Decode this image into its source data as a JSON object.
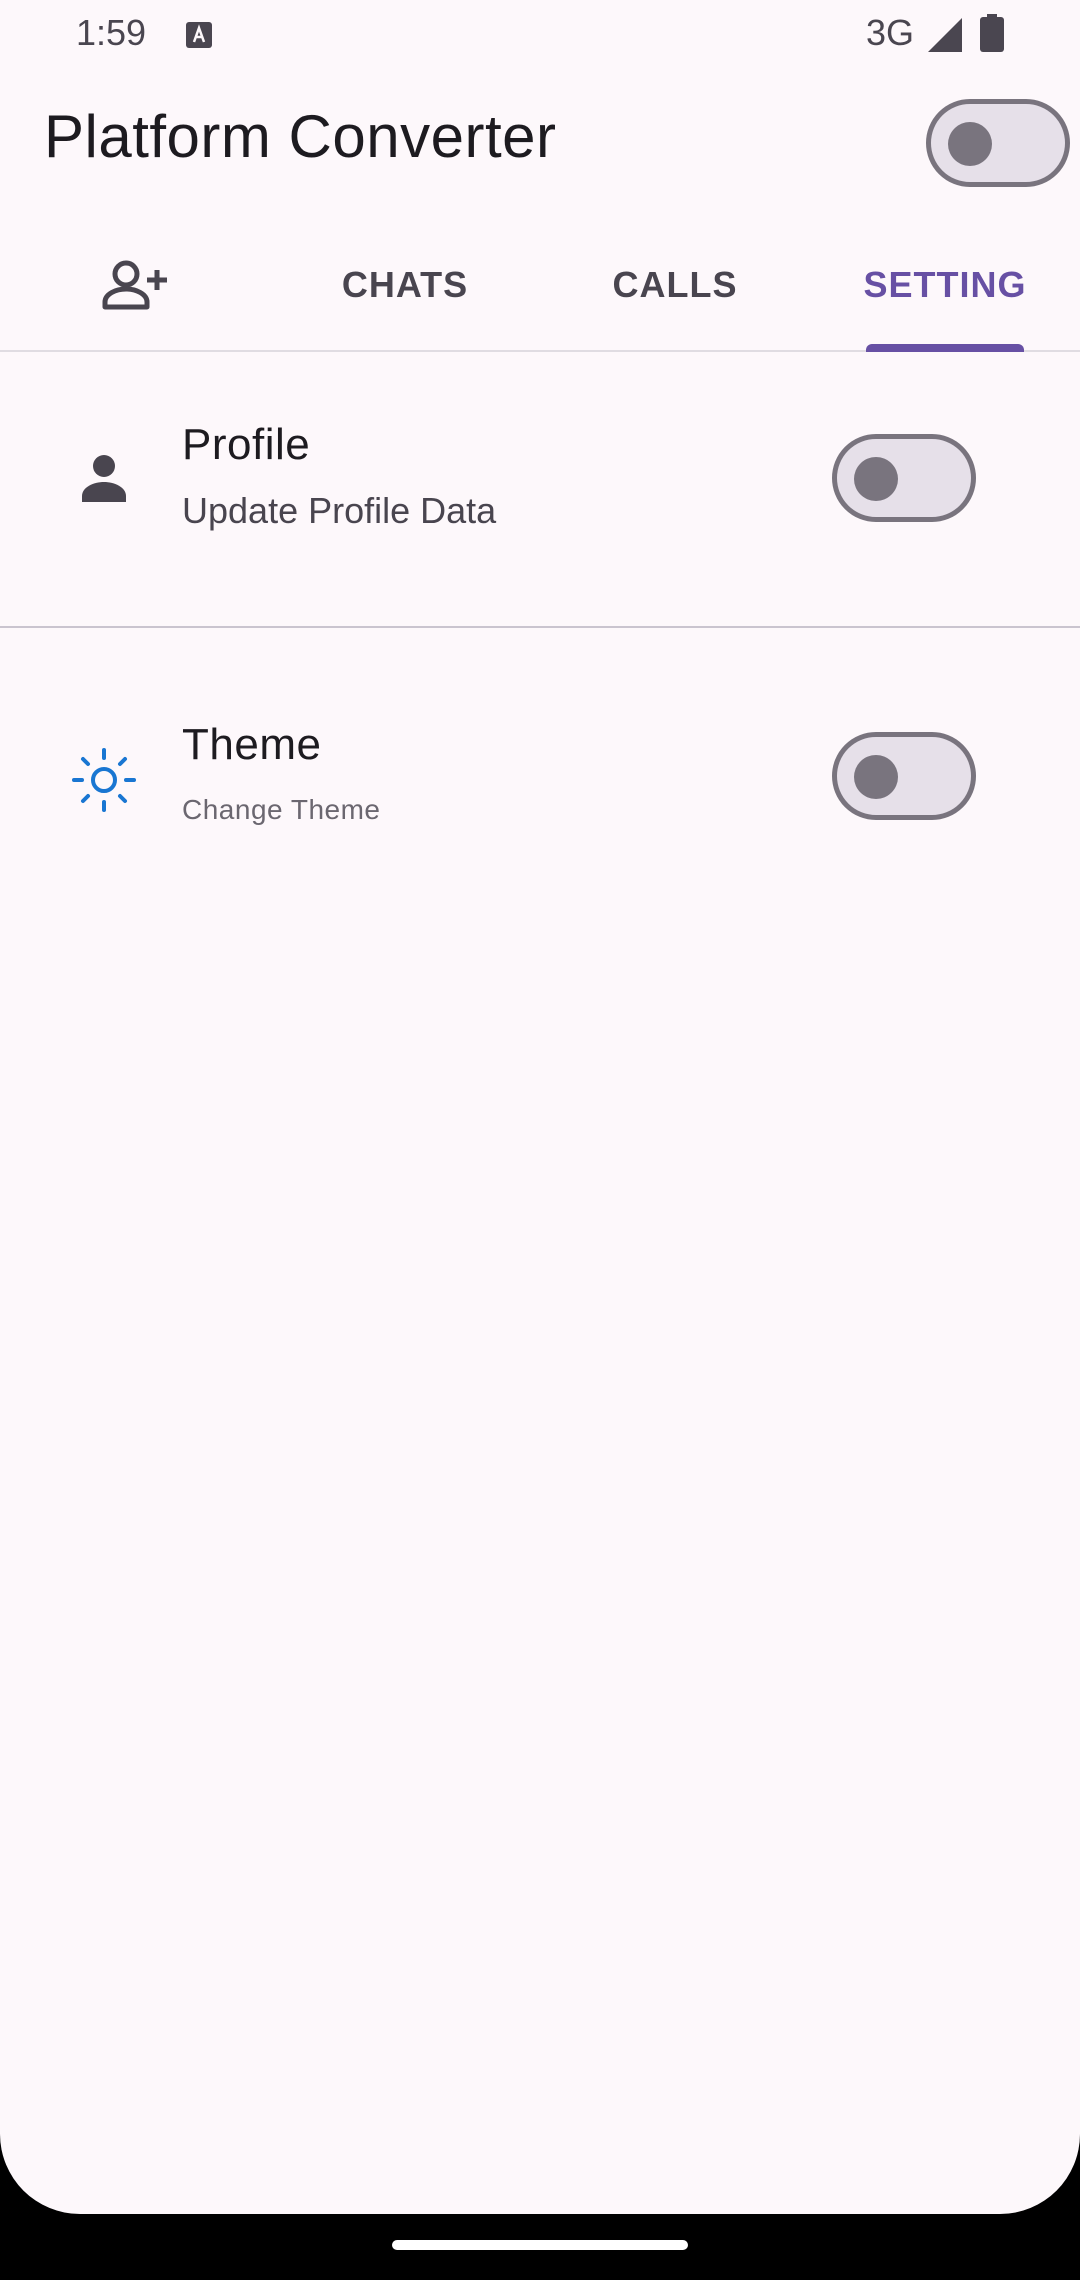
{
  "status_bar": {
    "time": "1:59",
    "network": "3G",
    "icons": [
      "text-a-icon",
      "signal-icon",
      "battery-icon"
    ]
  },
  "app_bar": {
    "title": "Platform Converter",
    "switch_on": false
  },
  "tabs": {
    "items": [
      {
        "label": "",
        "icon": "add-person-icon",
        "selected": false
      },
      {
        "label": "CHATS",
        "selected": false
      },
      {
        "label": "CALLS",
        "selected": false
      },
      {
        "label": "SETTING",
        "selected": true
      }
    ]
  },
  "settings": {
    "profile": {
      "title": "Profile",
      "subtitle": "Update Profile Data",
      "icon": "person-icon",
      "switch_on": false
    },
    "theme": {
      "title": "Theme",
      "subtitle": "Change Theme",
      "icon": "sun-icon",
      "switch_on": false
    }
  },
  "colors": {
    "accent": "#6750a4",
    "background": "#fdf8fb",
    "theme_icon": "#1976d2",
    "switch_track": "#e6e0e9",
    "switch_outline": "#79747e"
  }
}
